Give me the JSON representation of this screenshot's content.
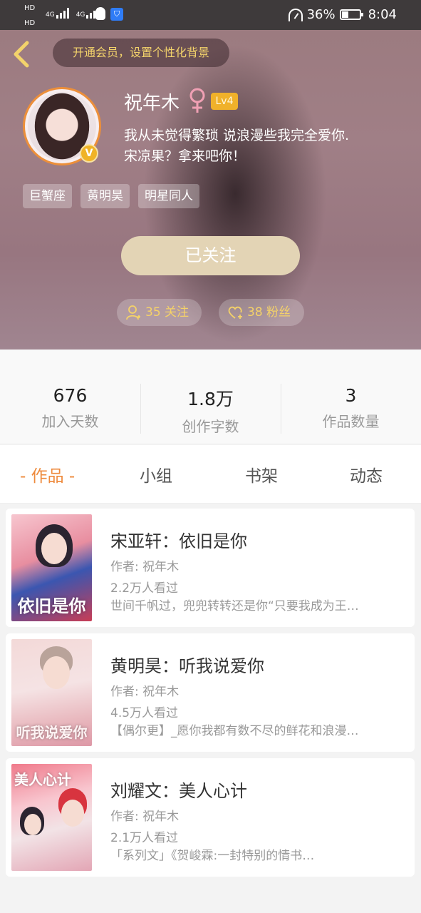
{
  "status_bar": {
    "hd1": "HD",
    "hd2": "HD",
    "net1": "4G",
    "net2": "4G",
    "battery_text": "36%",
    "battery_level": 0.36,
    "time": "8:04"
  },
  "header": {
    "vip_prompt": "开通会员，设置个性化背景",
    "name": "祝年木",
    "gender_symbol": "♀",
    "level": "Lv4",
    "bio_line1": "我从未觉得繁琐 说浪漫些我完全爱你.",
    "bio_line2": "宋凉果？拿来吧你！",
    "tags": [
      "巨蟹座",
      "黄明昊",
      "明星同人"
    ],
    "follow_button": "已关注",
    "following": "35 关注",
    "followers": "38 粉丝",
    "colors": {
      "accent_gold": "#f5d268",
      "level_badge": "#f0b12a",
      "avatar_ring": "#ec8f3a"
    }
  },
  "stats": [
    {
      "value": "676",
      "label": "加入天数"
    },
    {
      "value": "1.8万",
      "label": "创作字数"
    },
    {
      "value": "3",
      "label": "作品数量"
    }
  ],
  "tabs": [
    {
      "label": "- 作品 -",
      "active": true
    },
    {
      "label": "小组",
      "active": false
    },
    {
      "label": "书架",
      "active": false
    },
    {
      "label": "动态",
      "active": false
    }
  ],
  "works": [
    {
      "title": "宋亚轩：依旧是你",
      "author": "作者: 祝年木",
      "views": "2.2万人看过",
      "desc": "世间千帆过，兜兜转转还是你“只要我成为王…",
      "cover_text": "依旧是你"
    },
    {
      "title": "黄明昊：听我说爱你",
      "author": "作者: 祝年木",
      "views": "4.5万人看过",
      "desc": "【偶尔更】_愿你我都有数不尽的鲜花和浪漫…",
      "cover_text": "听我说爱你"
    },
    {
      "title": "刘耀文：美人心计",
      "author": "作者: 祝年木",
      "views": "2.1万人看过",
      "desc": "「系列文」《贺峻霖:一封特别的情书…",
      "cover_text": "美人心计"
    }
  ]
}
